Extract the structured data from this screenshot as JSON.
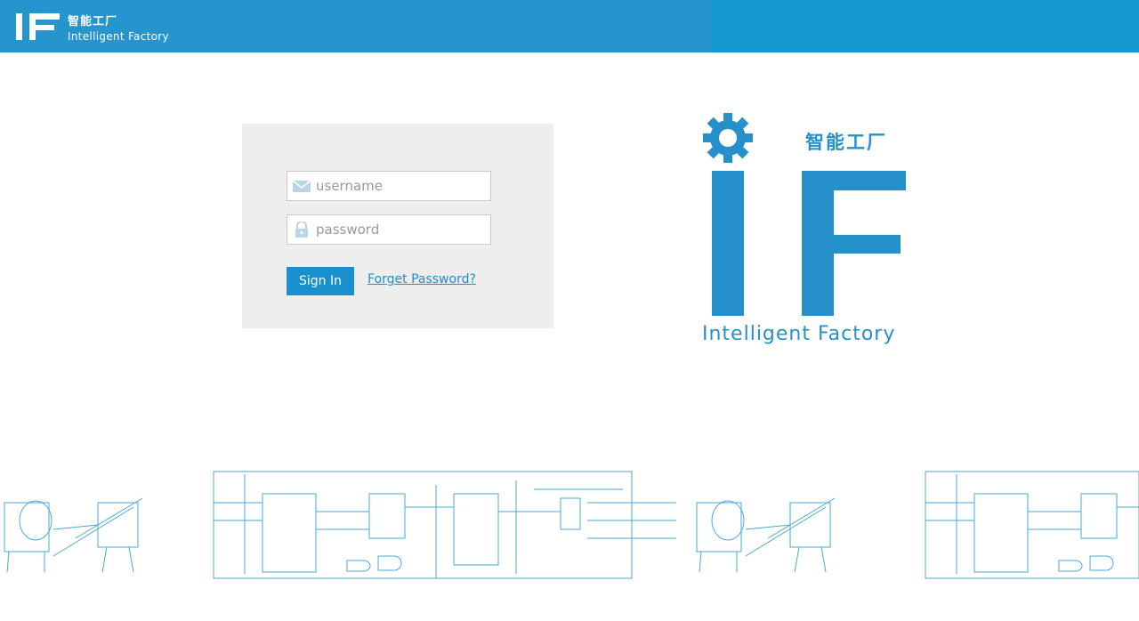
{
  "header": {
    "logo_letters": "IF",
    "title_cn": "智能工厂",
    "title_en": "Intelligent Factory"
  },
  "login": {
    "username_placeholder": "username",
    "password_placeholder": "password",
    "signin_label": "Sign In",
    "forgot_label": "Forget Password?"
  },
  "brand": {
    "title_cn": "智能工厂",
    "title_en": "Intelligent Factory"
  },
  "icons": {
    "username": "envelope-icon",
    "password": "lock-icon",
    "brand": "gear-icon"
  },
  "colors": {
    "header_bg": "#1597d0",
    "accent": "#1a8fcd",
    "login_panel": "#eeeeee"
  }
}
